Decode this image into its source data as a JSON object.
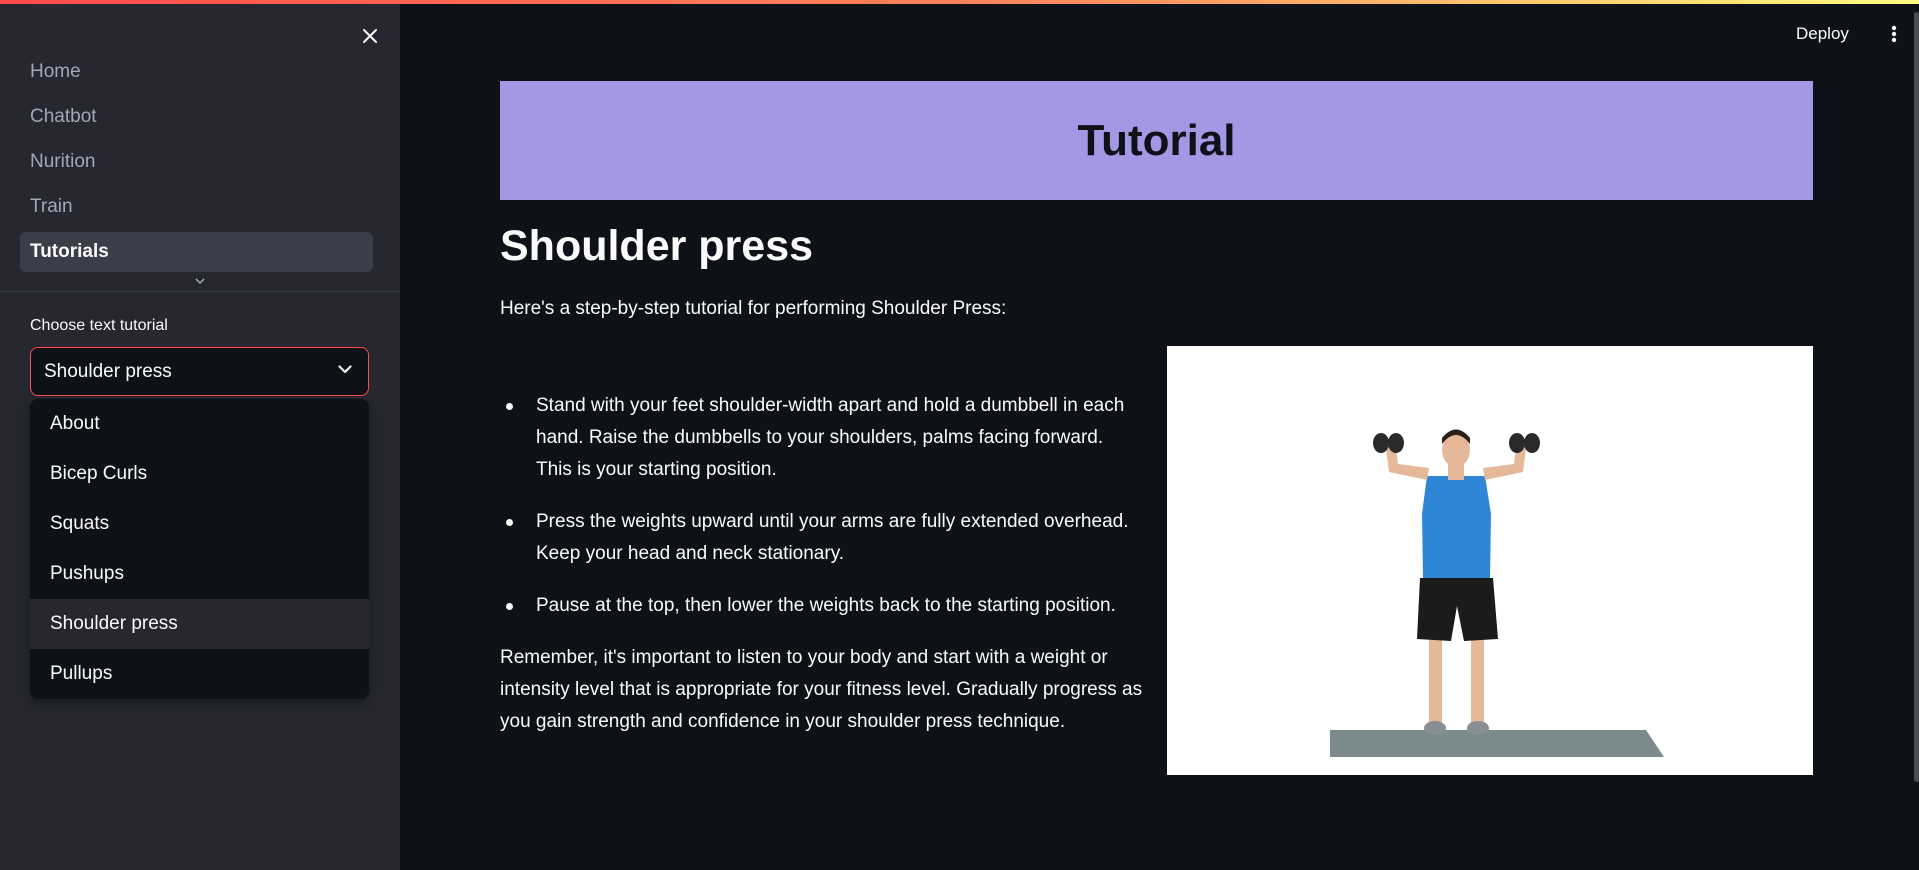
{
  "sidebar": {
    "nav_items": [
      {
        "label": "Home"
      },
      {
        "label": "Chatbot"
      },
      {
        "label": "Nurition"
      },
      {
        "label": "Train"
      },
      {
        "label": "Tutorials"
      }
    ],
    "select_label": "Choose text tutorial",
    "selected_value": "Shoulder press",
    "options": [
      "About",
      "Bicep Curls",
      "Squats",
      "Pushups",
      "Shoulder press",
      "Pullups"
    ]
  },
  "header": {
    "deploy_label": "Deploy"
  },
  "main": {
    "banner_title": "Tutorial",
    "heading": "Shoulder press",
    "intro": "Here's a step-by-step tutorial for performing Shoulder Press:",
    "steps": [
      "Stand with your feet shoulder-width apart and hold a dumbbell in each hand. Raise the dumbbells to your shoulders, palms facing forward. This is your starting position.",
      "Press the weights upward until your arms are fully extended overhead. Keep your head and neck stationary.",
      "Pause at the top, then lower the weights back to the starting position."
    ],
    "closing": "Remember, it's important to listen to your body and start with a weight or intensity level that is appropriate for your fitness level. Gradually progress as you gain strength and confidence in your shoulder press technique."
  },
  "colors": {
    "accent": "#ff4b4b",
    "banner": "#a497e4",
    "background": "#0e1117",
    "sidebar": "#262730"
  }
}
